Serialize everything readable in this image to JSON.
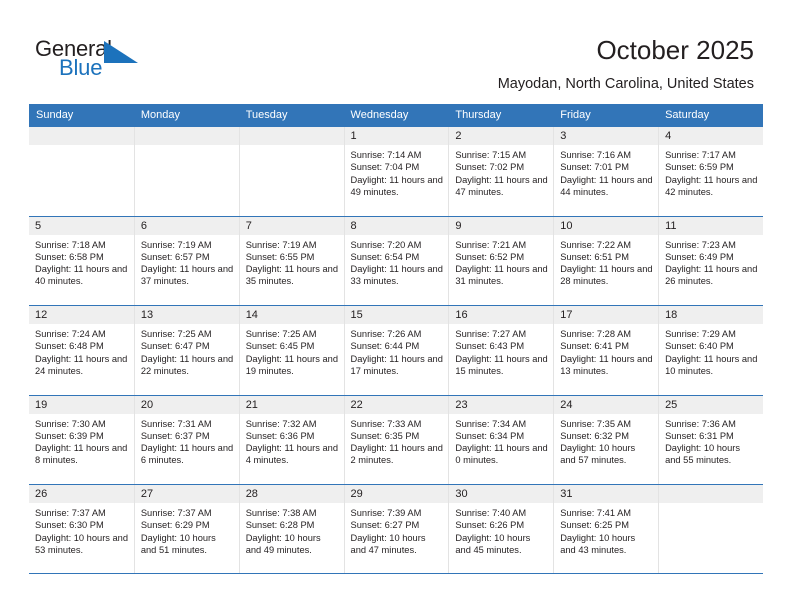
{
  "brand": {
    "line1": "General",
    "line2": "Blue",
    "triangle_color": "#1c72bc",
    "text_color": "#231f20"
  },
  "header": {
    "title": "October 2025",
    "subtitle": "Mayodan, North Carolina, United States"
  },
  "theme": {
    "header_bg": "#3275b8",
    "header_text": "#ffffff",
    "day_band_bg": "#efefef",
    "cell_border": "#e3e3e3",
    "text": "#231f20"
  },
  "weekdays": [
    "Sunday",
    "Monday",
    "Tuesday",
    "Wednesday",
    "Thursday",
    "Friday",
    "Saturday"
  ],
  "weeks": [
    [
      {
        "day": "",
        "sunrise": "",
        "sunset": "",
        "daylight": "",
        "empty": true
      },
      {
        "day": "",
        "sunrise": "",
        "sunset": "",
        "daylight": "",
        "empty": true
      },
      {
        "day": "",
        "sunrise": "",
        "sunset": "",
        "daylight": "",
        "empty": true
      },
      {
        "day": "1",
        "sunrise": "Sunrise: 7:14 AM",
        "sunset": "Sunset: 7:04 PM",
        "daylight": "Daylight: 11 hours and 49 minutes."
      },
      {
        "day": "2",
        "sunrise": "Sunrise: 7:15 AM",
        "sunset": "Sunset: 7:02 PM",
        "daylight": "Daylight: 11 hours and 47 minutes."
      },
      {
        "day": "3",
        "sunrise": "Sunrise: 7:16 AM",
        "sunset": "Sunset: 7:01 PM",
        "daylight": "Daylight: 11 hours and 44 minutes."
      },
      {
        "day": "4",
        "sunrise": "Sunrise: 7:17 AM",
        "sunset": "Sunset: 6:59 PM",
        "daylight": "Daylight: 11 hours and 42 minutes."
      }
    ],
    [
      {
        "day": "5",
        "sunrise": "Sunrise: 7:18 AM",
        "sunset": "Sunset: 6:58 PM",
        "daylight": "Daylight: 11 hours and 40 minutes."
      },
      {
        "day": "6",
        "sunrise": "Sunrise: 7:19 AM",
        "sunset": "Sunset: 6:57 PM",
        "daylight": "Daylight: 11 hours and 37 minutes."
      },
      {
        "day": "7",
        "sunrise": "Sunrise: 7:19 AM",
        "sunset": "Sunset: 6:55 PM",
        "daylight": "Daylight: 11 hours and 35 minutes."
      },
      {
        "day": "8",
        "sunrise": "Sunrise: 7:20 AM",
        "sunset": "Sunset: 6:54 PM",
        "daylight": "Daylight: 11 hours and 33 minutes."
      },
      {
        "day": "9",
        "sunrise": "Sunrise: 7:21 AM",
        "sunset": "Sunset: 6:52 PM",
        "daylight": "Daylight: 11 hours and 31 minutes."
      },
      {
        "day": "10",
        "sunrise": "Sunrise: 7:22 AM",
        "sunset": "Sunset: 6:51 PM",
        "daylight": "Daylight: 11 hours and 28 minutes."
      },
      {
        "day": "11",
        "sunrise": "Sunrise: 7:23 AM",
        "sunset": "Sunset: 6:49 PM",
        "daylight": "Daylight: 11 hours and 26 minutes."
      }
    ],
    [
      {
        "day": "12",
        "sunrise": "Sunrise: 7:24 AM",
        "sunset": "Sunset: 6:48 PM",
        "daylight": "Daylight: 11 hours and 24 minutes."
      },
      {
        "day": "13",
        "sunrise": "Sunrise: 7:25 AM",
        "sunset": "Sunset: 6:47 PM",
        "daylight": "Daylight: 11 hours and 22 minutes."
      },
      {
        "day": "14",
        "sunrise": "Sunrise: 7:25 AM",
        "sunset": "Sunset: 6:45 PM",
        "daylight": "Daylight: 11 hours and 19 minutes."
      },
      {
        "day": "15",
        "sunrise": "Sunrise: 7:26 AM",
        "sunset": "Sunset: 6:44 PM",
        "daylight": "Daylight: 11 hours and 17 minutes."
      },
      {
        "day": "16",
        "sunrise": "Sunrise: 7:27 AM",
        "sunset": "Sunset: 6:43 PM",
        "daylight": "Daylight: 11 hours and 15 minutes."
      },
      {
        "day": "17",
        "sunrise": "Sunrise: 7:28 AM",
        "sunset": "Sunset: 6:41 PM",
        "daylight": "Daylight: 11 hours and 13 minutes."
      },
      {
        "day": "18",
        "sunrise": "Sunrise: 7:29 AM",
        "sunset": "Sunset: 6:40 PM",
        "daylight": "Daylight: 11 hours and 10 minutes."
      }
    ],
    [
      {
        "day": "19",
        "sunrise": "Sunrise: 7:30 AM",
        "sunset": "Sunset: 6:39 PM",
        "daylight": "Daylight: 11 hours and 8 minutes."
      },
      {
        "day": "20",
        "sunrise": "Sunrise: 7:31 AM",
        "sunset": "Sunset: 6:37 PM",
        "daylight": "Daylight: 11 hours and 6 minutes."
      },
      {
        "day": "21",
        "sunrise": "Sunrise: 7:32 AM",
        "sunset": "Sunset: 6:36 PM",
        "daylight": "Daylight: 11 hours and 4 minutes."
      },
      {
        "day": "22",
        "sunrise": "Sunrise: 7:33 AM",
        "sunset": "Sunset: 6:35 PM",
        "daylight": "Daylight: 11 hours and 2 minutes."
      },
      {
        "day": "23",
        "sunrise": "Sunrise: 7:34 AM",
        "sunset": "Sunset: 6:34 PM",
        "daylight": "Daylight: 11 hours and 0 minutes."
      },
      {
        "day": "24",
        "sunrise": "Sunrise: 7:35 AM",
        "sunset": "Sunset: 6:32 PM",
        "daylight": "Daylight: 10 hours and 57 minutes."
      },
      {
        "day": "25",
        "sunrise": "Sunrise: 7:36 AM",
        "sunset": "Sunset: 6:31 PM",
        "daylight": "Daylight: 10 hours and 55 minutes."
      }
    ],
    [
      {
        "day": "26",
        "sunrise": "Sunrise: 7:37 AM",
        "sunset": "Sunset: 6:30 PM",
        "daylight": "Daylight: 10 hours and 53 minutes."
      },
      {
        "day": "27",
        "sunrise": "Sunrise: 7:37 AM",
        "sunset": "Sunset: 6:29 PM",
        "daylight": "Daylight: 10 hours and 51 minutes."
      },
      {
        "day": "28",
        "sunrise": "Sunrise: 7:38 AM",
        "sunset": "Sunset: 6:28 PM",
        "daylight": "Daylight: 10 hours and 49 minutes."
      },
      {
        "day": "29",
        "sunrise": "Sunrise: 7:39 AM",
        "sunset": "Sunset: 6:27 PM",
        "daylight": "Daylight: 10 hours and 47 minutes."
      },
      {
        "day": "30",
        "sunrise": "Sunrise: 7:40 AM",
        "sunset": "Sunset: 6:26 PM",
        "daylight": "Daylight: 10 hours and 45 minutes."
      },
      {
        "day": "31",
        "sunrise": "Sunrise: 7:41 AM",
        "sunset": "Sunset: 6:25 PM",
        "daylight": "Daylight: 10 hours and 43 minutes."
      },
      {
        "day": "",
        "sunrise": "",
        "sunset": "",
        "daylight": "",
        "empty": true
      }
    ]
  ]
}
